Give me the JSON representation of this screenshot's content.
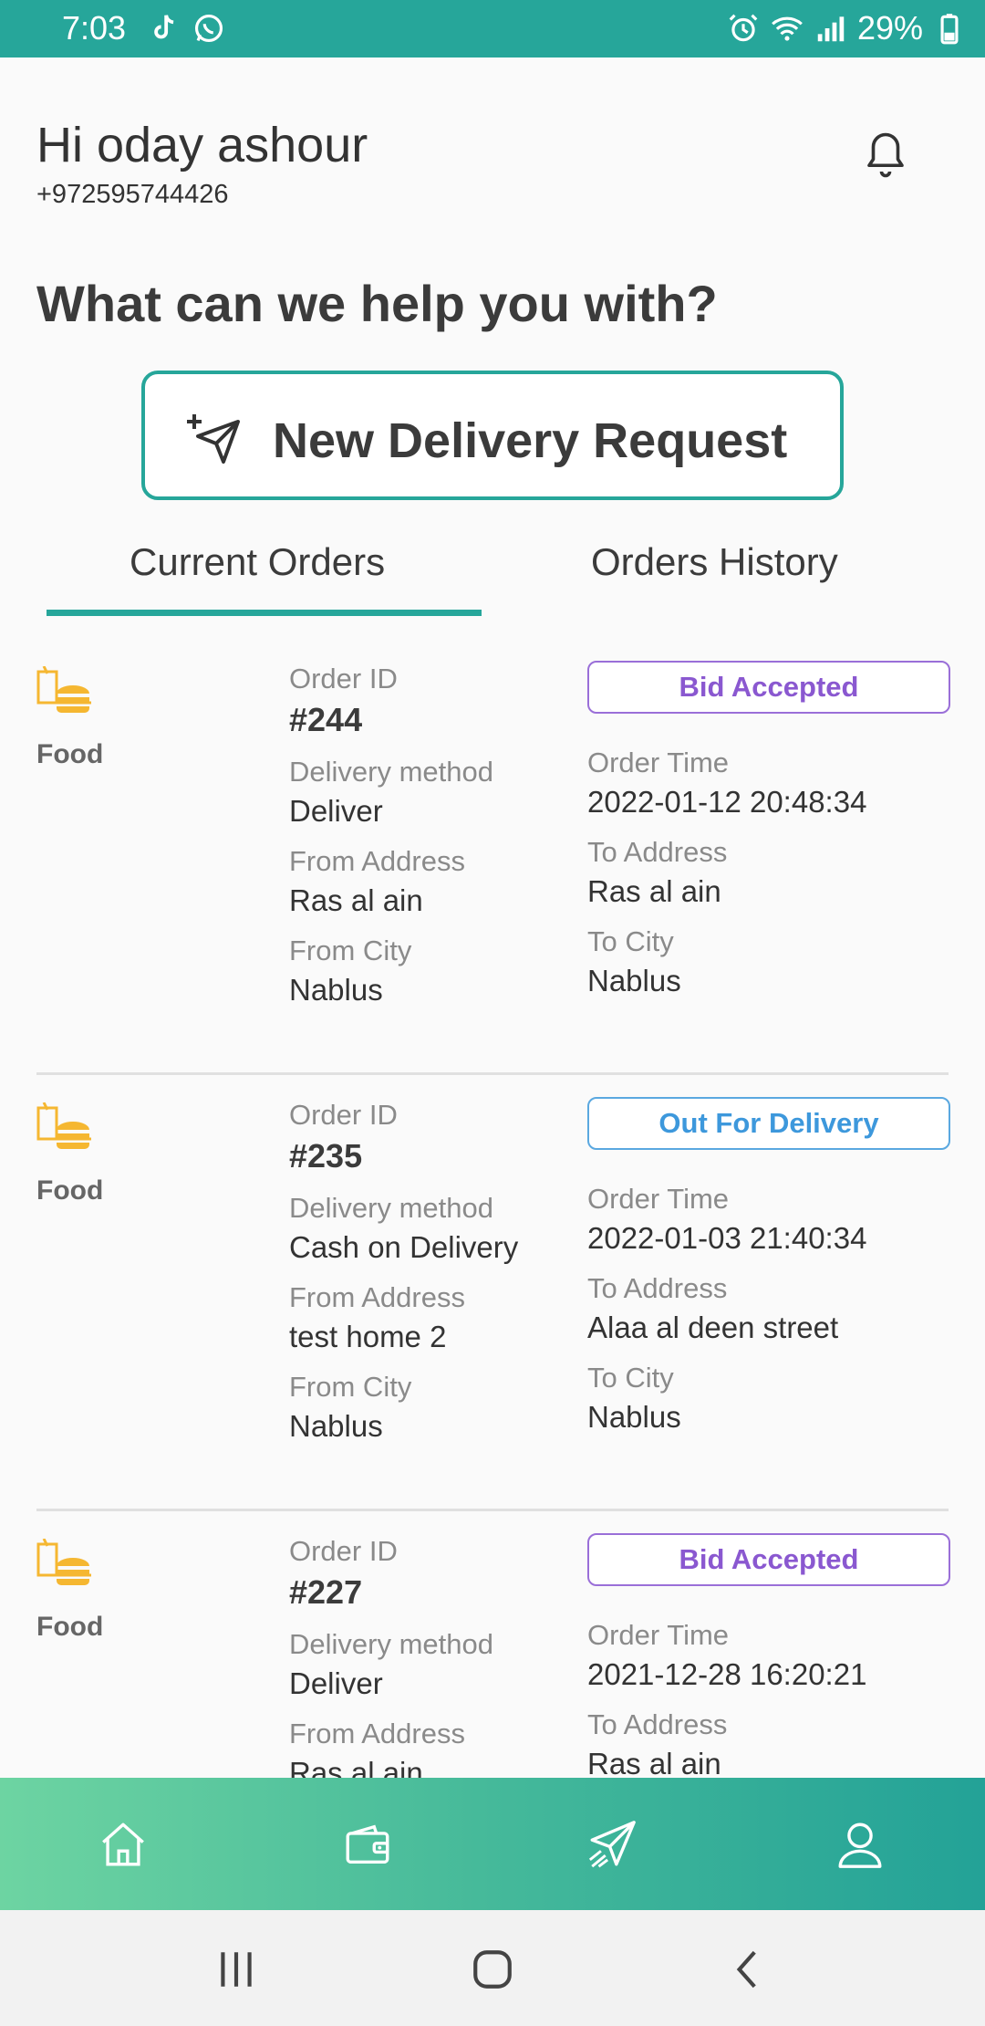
{
  "status_bar": {
    "time": "7:03",
    "battery": "29%",
    "icons_left": [
      "tiktok-icon",
      "whatsapp-icon"
    ],
    "icons_right": [
      "alarm-icon",
      "wifi-icon",
      "signal-icon",
      "battery-icon"
    ]
  },
  "header": {
    "greeting": "Hi oday ashour",
    "phone": "+972595744426",
    "notification_icon": "bell-icon"
  },
  "help": {
    "title": "What can we help you with?",
    "new_request_label": "New Delivery Request"
  },
  "tabs": [
    {
      "label": "Current Orders",
      "active": true
    },
    {
      "label": "Orders History",
      "active": false
    }
  ],
  "field_labels": {
    "order_id": "Order ID",
    "delivery_method": "Delivery method",
    "from_address": "From Address",
    "from_city": "From City",
    "order_time": "Order Time",
    "to_address": "To Address",
    "to_city": "To City"
  },
  "orders": [
    {
      "category": "Food",
      "order_id": "#244",
      "status": "Bid Accepted",
      "delivery_method": "Deliver",
      "from_address": "Ras al ain",
      "from_city": "Nablus",
      "order_time": "2022-01-12 20:48:34",
      "to_address": "Ras al ain",
      "to_city": "Nablus"
    },
    {
      "category": "Food",
      "order_id": "#235",
      "status": "Out For Delivery",
      "delivery_method": "Cash on Delivery",
      "from_address": "test home 2",
      "from_city": "Nablus",
      "order_time": "2022-01-03 21:40:34",
      "to_address": "Alaa al deen street",
      "to_city": "Nablus"
    },
    {
      "category": "Food",
      "order_id": "#227",
      "status": "Bid Accepted",
      "delivery_method": "Deliver",
      "from_address": "Ras al ain",
      "from_city": "",
      "order_time": "2021-12-28 16:20:21",
      "to_address": "Ras al ain",
      "to_city": ""
    }
  ],
  "colors": {
    "primary": "#26a69a",
    "bid_accepted": "#8a58d0",
    "out_for_delivery": "#3d98dc"
  },
  "bottom_nav": [
    "home-icon",
    "wallet-icon",
    "send-icon",
    "profile-icon"
  ],
  "system_nav": [
    "recents-icon",
    "home-circle-icon",
    "back-icon"
  ]
}
